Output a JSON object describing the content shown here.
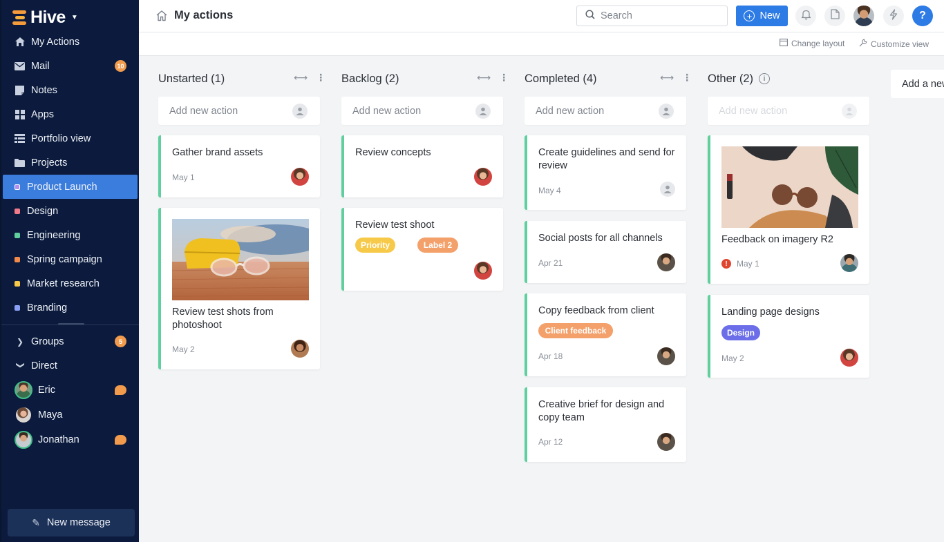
{
  "app": {
    "name": "Hive"
  },
  "sidebar": {
    "nav": [
      {
        "label": "My Actions",
        "icon": "home-icon"
      },
      {
        "label": "Mail",
        "icon": "mail-icon",
        "badge": "10"
      },
      {
        "label": "Notes",
        "icon": "notes-icon"
      },
      {
        "label": "Apps",
        "icon": "apps-icon"
      },
      {
        "label": "Portfolio view",
        "icon": "portfolio-icon"
      },
      {
        "label": "Projects",
        "icon": "folder-icon"
      }
    ],
    "projects": [
      {
        "label": "Product Launch",
        "color": "#b58cf0",
        "active": true
      },
      {
        "label": "Design",
        "color": "#f07a8a"
      },
      {
        "label": "Engineering",
        "color": "#5fcf9e"
      },
      {
        "label": "Spring campaign",
        "color": "#f38a4a"
      },
      {
        "label": "Market research",
        "color": "#f7c948"
      },
      {
        "label": "Branding",
        "color": "#8aa0f5"
      }
    ],
    "groups": {
      "label": "Groups",
      "badge": "5"
    },
    "direct": {
      "label": "Direct"
    },
    "people": [
      {
        "name": "Eric",
        "unread": true
      },
      {
        "name": "Maya",
        "unread": false
      },
      {
        "name": "Jonathan",
        "unread": true
      }
    ],
    "new_message": "New message"
  },
  "topbar": {
    "title": "My actions",
    "search_placeholder": "Search",
    "new_label": "New",
    "help": "?"
  },
  "subbar": {
    "change_layout": "Change layout",
    "customize_view": "Customize view"
  },
  "board": {
    "add_placeholder": "Add new action",
    "add_list": "Add a new",
    "columns": [
      {
        "title": "Unstarted (1)",
        "cards": [
          {
            "title": "Gather brand assets",
            "date": "May 1"
          },
          {
            "title": "Review test shots from photoshoot",
            "date": "May 2",
            "image": "sunglasses-photo"
          }
        ]
      },
      {
        "title": "Backlog (2)",
        "cards": [
          {
            "title": "Review concepts"
          },
          {
            "title": "Review test shoot",
            "labels": [
              {
                "text": "Priority",
                "color": "#f7c948"
              },
              {
                "text": "Label 2",
                "color": "#f4a06a"
              }
            ]
          }
        ]
      },
      {
        "title": "Completed (4)",
        "cards": [
          {
            "title": "Create guidelines and send for review",
            "date": "May 4"
          },
          {
            "title": "Social posts for all channels",
            "date": "Apr 21"
          },
          {
            "title": "Copy feedback from client",
            "date": "Apr 18",
            "labels": [
              {
                "text": "Client feedback",
                "color": "#f4a06a"
              }
            ]
          },
          {
            "title": "Creative brief for design and copy team",
            "date": "Apr 12"
          }
        ]
      },
      {
        "title": "Other (2)",
        "cards": [
          {
            "title": "Feedback on imagery R2",
            "date": "May 1",
            "overdue": true,
            "image": "accessories-photo"
          },
          {
            "title": "Landing page designs",
            "date": "May 2",
            "labels": [
              {
                "text": "Design",
                "color": "#6b6ee8"
              }
            ]
          }
        ]
      }
    ]
  }
}
